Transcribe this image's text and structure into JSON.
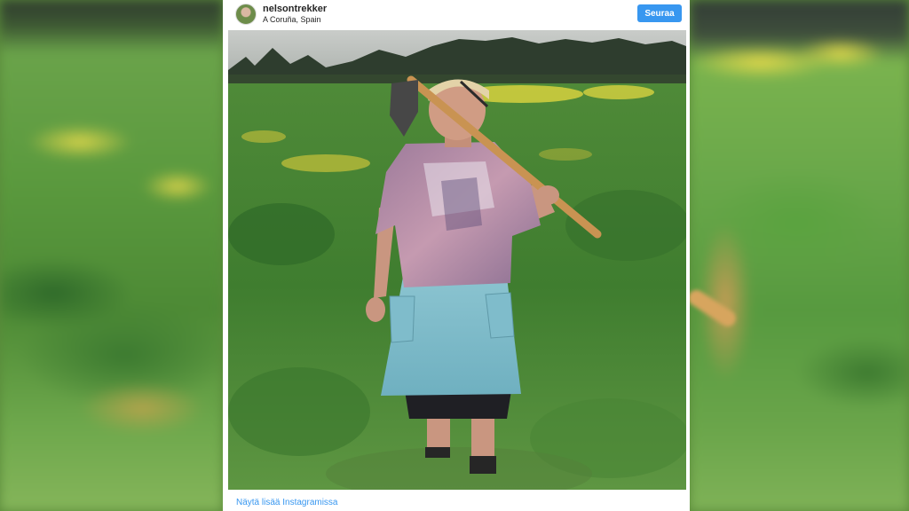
{
  "post": {
    "username": "nelsontrekker",
    "location": "A Coruña, Spain",
    "follow_label": "Seuraa",
    "view_more_label": "Näytä lisää Instagramissa"
  },
  "colors": {
    "accent": "#3897f0",
    "card_background": "#ffffff",
    "text": "#262626"
  },
  "icons": {
    "avatar": "profile-photo"
  }
}
